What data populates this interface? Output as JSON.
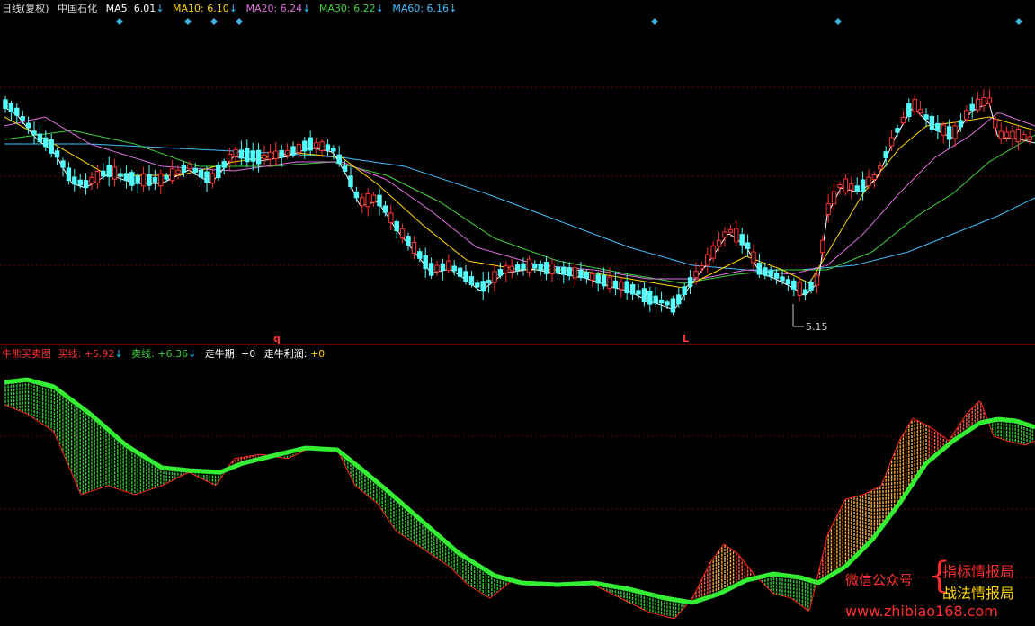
{
  "top": {
    "period": "日线(复权)",
    "stock": "中国石化",
    "ma": [
      {
        "label": "MA5: 6.01",
        "arrow": "↓",
        "color": "#ffffff"
      },
      {
        "label": "MA10: 6.10",
        "arrow": "↓",
        "color": "#ffd700"
      },
      {
        "label": "MA20: 6.24",
        "arrow": "↓",
        "color": "#e070e0"
      },
      {
        "label": "MA30: 6.22",
        "arrow": "↓",
        "color": "#40d040"
      },
      {
        "label": "MA60: 6.16",
        "arrow": "↓",
        "color": "#40c0ff"
      }
    ],
    "marker_q": "q",
    "marker_l": "L",
    "low_label": "5.15"
  },
  "bottom": {
    "indicator": "牛熊买卖图",
    "buy_label": "买线:",
    "buy_value": "+5.92",
    "buy_arrow": "↓",
    "sell_label": "卖线:",
    "sell_value": "+6.36",
    "sell_arrow": "↓",
    "bull_period_label": "走牛期:",
    "bull_period_value": "+0",
    "bull_profit_label": "走牛利润:",
    "bull_profit_value": "+0"
  },
  "watermark": {
    "wechat": "微信公众号",
    "brace": "{",
    "line1": "指标情报局",
    "line2": "战法情报局",
    "url": "www.zhibiao168.com"
  },
  "colors": {
    "up": "#ff3232",
    "down": "#54ffff",
    "buy_line": "#33ee33",
    "grid": "#8b0000"
  }
}
